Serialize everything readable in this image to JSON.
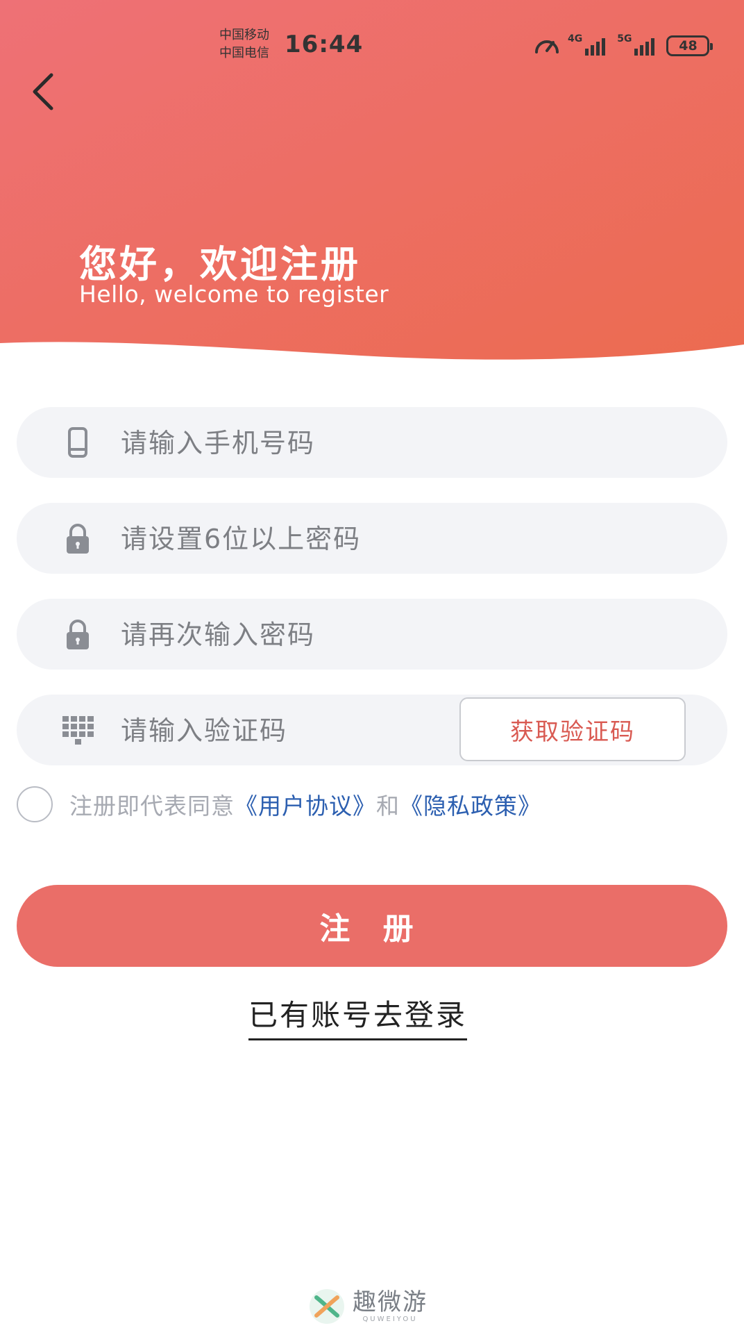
{
  "status_bar": {
    "carrier_1": "中国移动",
    "carrier_2": "中国电信",
    "time": "16:44",
    "network_1": "4G",
    "network_2": "5G",
    "battery": "48"
  },
  "header": {
    "title": "您好，欢迎注册",
    "subtitle": "Hello, welcome to register",
    "gradient_start": "#ee7075",
    "gradient_end": "#ec6c52"
  },
  "form": {
    "phone_placeholder": "请输入手机号码",
    "password_placeholder": "请设置6位以上密码",
    "confirm_placeholder": "请再次输入密码",
    "code_placeholder": "请输入验证码",
    "get_code_label": "获取验证码"
  },
  "agreement": {
    "prefix": "注册即代表同意",
    "user_agreement": "《用户协议》",
    "conjunction": "和",
    "privacy_policy": "《隐私政策》",
    "checked": false
  },
  "actions": {
    "register_label": "注 册",
    "login_label": "已有账号去登录"
  },
  "watermark": {
    "name": "趣微游",
    "sub": "QUWEIYOU"
  },
  "icons": {
    "back": "chevron-left-icon",
    "phone": "phone-icon",
    "lock": "lock-icon",
    "keypad": "keypad-icon"
  }
}
